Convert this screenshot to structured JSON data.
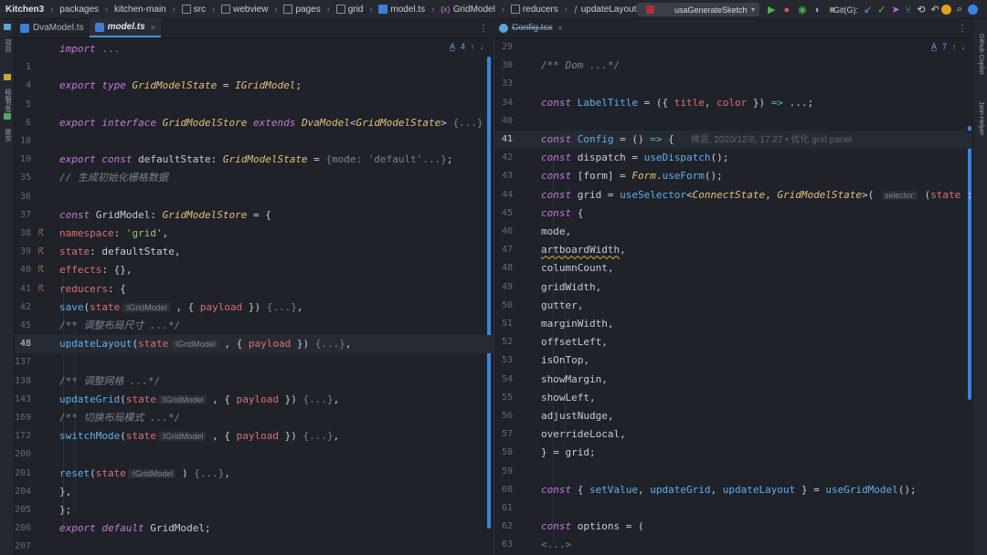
{
  "nav": {
    "breadcrumbs": [
      "Kitchen3",
      "packages",
      "kitchen-main",
      "src",
      "webview",
      "pages",
      "grid",
      "model.ts",
      "GridModel",
      "reducers",
      "updateLayout()"
    ],
    "run_config": "usaGenerateSketch",
    "git_label": "Git(G):"
  },
  "tabs_left": [
    {
      "label": "DvaModel.ts",
      "active": false
    },
    {
      "label": "model.ts",
      "active": true
    }
  ],
  "tabs_right": [
    {
      "label": "Config.tsx",
      "active": false
    }
  ],
  "left_status": {
    "warnings": "4"
  },
  "right_status": {
    "warnings": "7"
  },
  "left_strip": [
    "项目",
    "结构",
    "书签",
    "提交"
  ],
  "right_strip": [
    "Github Copilot",
    "Json Helper"
  ],
  "left_lines": [
    {
      "n": "",
      "t": [
        [
          "kw",
          "import"
        ],
        [
          "df",
          " "
        ],
        [
          "fold",
          "..."
        ]
      ]
    },
    {
      "n": "1",
      "t": []
    },
    {
      "n": "4",
      "t": [
        [
          "kw",
          "export"
        ],
        [
          "df",
          " "
        ],
        [
          "kw",
          "type"
        ],
        [
          "df",
          " "
        ],
        [
          "ty",
          "GridModelState"
        ],
        [
          "df",
          " = "
        ],
        [
          "ty",
          "IGridModel"
        ],
        [
          "df",
          ";"
        ]
      ]
    },
    {
      "n": "5",
      "t": []
    },
    {
      "n": "6",
      "t": [
        [
          "kw",
          "export"
        ],
        [
          "df",
          " "
        ],
        [
          "kw",
          "interface"
        ],
        [
          "df",
          " "
        ],
        [
          "ty",
          "GridModelStore"
        ],
        [
          "df",
          " "
        ],
        [
          "kw",
          "extends"
        ],
        [
          "df",
          " "
        ],
        [
          "ty",
          "DvaModel"
        ],
        [
          "df",
          "<"
        ],
        [
          "ty",
          "GridModelState"
        ],
        [
          "df",
          "> "
        ],
        [
          "fold",
          "{...}"
        ]
      ]
    },
    {
      "n": "18",
      "t": []
    },
    {
      "n": "19",
      "t": [
        [
          "kw",
          "export"
        ],
        [
          "df",
          " "
        ],
        [
          "kw",
          "const"
        ],
        [
          "df",
          " defaultState: "
        ],
        [
          "ty",
          "GridModelState"
        ],
        [
          "df",
          " = "
        ],
        [
          "fold",
          "{mode: 'default'...}"
        ],
        [
          "df",
          ";"
        ]
      ]
    },
    {
      "n": "35",
      "t": [
        [
          "cm",
          "// 生成初始化栅格数据"
        ]
      ]
    },
    {
      "n": "36",
      "t": []
    },
    {
      "n": "37",
      "t": [
        [
          "kw",
          "const"
        ],
        [
          "df",
          " GridModel: "
        ],
        [
          "ty",
          "GridModelStore"
        ],
        [
          "df",
          " = {"
        ]
      ]
    },
    {
      "n": "38",
      "g": true,
      "t": [
        [
          "df",
          "  "
        ],
        [
          "pr",
          "namespace"
        ],
        [
          "df",
          ": "
        ],
        [
          "st",
          "'grid'"
        ],
        [
          "df",
          ","
        ]
      ]
    },
    {
      "n": "39",
      "g": true,
      "t": [
        [
          "df",
          "  "
        ],
        [
          "pr",
          "state"
        ],
        [
          "df",
          ": defaultState,"
        ]
      ]
    },
    {
      "n": "40",
      "g": true,
      "t": [
        [
          "df",
          "  "
        ],
        [
          "pr",
          "effects"
        ],
        [
          "df",
          ": {},"
        ]
      ]
    },
    {
      "n": "41",
      "g": true,
      "t": [
        [
          "df",
          "  "
        ],
        [
          "pr",
          "reducers"
        ],
        [
          "df",
          ": {"
        ]
      ]
    },
    {
      "n": "42",
      "t": [
        [
          "df",
          "    "
        ],
        [
          "fn",
          "save"
        ],
        [
          "df",
          "("
        ],
        [
          "pr",
          "state"
        ],
        [
          "hint",
          ":IGridModel"
        ],
        [
          "df",
          " , { "
        ],
        [
          "pr",
          "payload"
        ],
        [
          "df",
          " }) "
        ],
        [
          "fold",
          "{...}"
        ],
        [
          "df",
          ","
        ]
      ]
    },
    {
      "n": "45",
      "t": [
        [
          "df",
          "    "
        ],
        [
          "cm",
          "/** 调整布局尺寸 ...*/"
        ]
      ]
    },
    {
      "n": "48",
      "cur": true,
      "t": [
        [
          "df",
          "    "
        ],
        [
          "fn",
          "updateLayout"
        ],
        [
          "df",
          "("
        ],
        [
          "pr",
          "state"
        ],
        [
          "hint",
          ":IGridModel"
        ],
        [
          "df",
          " , { "
        ],
        [
          "pr",
          "payload"
        ],
        [
          "df",
          " }) "
        ],
        [
          "fold",
          "{...}"
        ],
        [
          "df",
          ","
        ]
      ]
    },
    {
      "n": "137",
      "t": []
    },
    {
      "n": "138",
      "t": [
        [
          "df",
          "    "
        ],
        [
          "cm",
          "/** 调整网格 ...*/"
        ]
      ]
    },
    {
      "n": "143",
      "t": [
        [
          "df",
          "    "
        ],
        [
          "fn",
          "updateGrid"
        ],
        [
          "df",
          "("
        ],
        [
          "pr",
          "state"
        ],
        [
          "hint",
          ":IGridModel"
        ],
        [
          "df",
          " , { "
        ],
        [
          "pr",
          "payload"
        ],
        [
          "df",
          " }) "
        ],
        [
          "fold",
          "{...}"
        ],
        [
          "df",
          ","
        ]
      ]
    },
    {
      "n": "169",
      "t": [
        [
          "df",
          "    "
        ],
        [
          "cm",
          "/** 切换布局模式 ...*/"
        ]
      ]
    },
    {
      "n": "172",
      "t": [
        [
          "df",
          "    "
        ],
        [
          "fn",
          "switchMode"
        ],
        [
          "df",
          "("
        ],
        [
          "pr",
          "state"
        ],
        [
          "hint",
          ":IGridModel"
        ],
        [
          "df",
          " , { "
        ],
        [
          "pr",
          "payload"
        ],
        [
          "df",
          " }) "
        ],
        [
          "fold",
          "{...}"
        ],
        [
          "df",
          ","
        ]
      ]
    },
    {
      "n": "200",
      "t": []
    },
    {
      "n": "201",
      "t": [
        [
          "df",
          "    "
        ],
        [
          "fn",
          "reset"
        ],
        [
          "df",
          "("
        ],
        [
          "pr",
          "state"
        ],
        [
          "hint",
          ":IGridModel"
        ],
        [
          "df",
          " ) "
        ],
        [
          "fold",
          "{...}"
        ],
        [
          "df",
          ","
        ]
      ]
    },
    {
      "n": "204",
      "t": [
        [
          "df",
          "  },"
        ]
      ]
    },
    {
      "n": "205",
      "t": [
        [
          "df",
          "};"
        ]
      ]
    },
    {
      "n": "206",
      "t": [
        [
          "kw",
          "export"
        ],
        [
          "df",
          " "
        ],
        [
          "kw",
          "default"
        ],
        [
          "df",
          " GridModel;"
        ]
      ]
    },
    {
      "n": "207",
      "t": []
    }
  ],
  "right_lines": [
    {
      "n": "29",
      "t": []
    },
    {
      "n": "30",
      "t": [
        [
          "cm",
          "/** Dom ...*/"
        ]
      ]
    },
    {
      "n": "33",
      "t": []
    },
    {
      "n": "34",
      "t": [
        [
          "kw",
          "const"
        ],
        [
          "df",
          " "
        ],
        [
          "fn",
          "LabelTitle"
        ],
        [
          "df",
          " = ({ "
        ],
        [
          "pr",
          "title"
        ],
        [
          "df",
          ", "
        ],
        [
          "pr",
          "color"
        ],
        [
          "df",
          " }) "
        ],
        [
          "op",
          "=>"
        ],
        [
          "df",
          " ...;"
        ]
      ]
    },
    {
      "n": "40",
      "t": []
    },
    {
      "n": "41",
      "cur": true,
      "t": [
        [
          "kw",
          "const"
        ],
        [
          "df",
          " "
        ],
        [
          "fn",
          "Config"
        ],
        [
          "df",
          " = () "
        ],
        [
          "op",
          "=>"
        ],
        [
          "df",
          " {"
        ],
        [
          "blame",
          "佛昱, 2020/12/8, 17:27 • 优化 grid panel"
        ]
      ]
    },
    {
      "n": "42",
      "t": [
        [
          "df",
          "  "
        ],
        [
          "kw",
          "const"
        ],
        [
          "df",
          " dispatch = "
        ],
        [
          "fn",
          "useDispatch"
        ],
        [
          "df",
          "();"
        ]
      ]
    },
    {
      "n": "43",
      "t": [
        [
          "df",
          "  "
        ],
        [
          "kw",
          "const"
        ],
        [
          "df",
          " [form] = "
        ],
        [
          "ty",
          "Form"
        ],
        [
          "df",
          "."
        ],
        [
          "fn",
          "useForm"
        ],
        [
          "df",
          "();"
        ]
      ]
    },
    {
      "n": "44",
      "t": [
        [
          "df",
          "  "
        ],
        [
          "kw",
          "const"
        ],
        [
          "df",
          " grid = "
        ],
        [
          "fn",
          "useSelector"
        ],
        [
          "df",
          "<"
        ],
        [
          "ty",
          "ConnectState"
        ],
        [
          "df",
          ", "
        ],
        [
          "ty",
          "GridModelState"
        ],
        [
          "df",
          ">( "
        ],
        [
          "hint",
          "selector:"
        ],
        [
          "df",
          " ("
        ],
        [
          "pr",
          "state"
        ],
        [
          "df",
          " :"
        ]
      ]
    },
    {
      "n": "45",
      "t": [
        [
          "df",
          "  "
        ],
        [
          "kw",
          "const"
        ],
        [
          "df",
          " {"
        ]
      ]
    },
    {
      "n": "46",
      "t": [
        [
          "df",
          "    mode,"
        ]
      ]
    },
    {
      "n": "47",
      "t": [
        [
          "df",
          "    "
        ],
        [
          "wv",
          "artboardWidth"
        ],
        [
          "df",
          ","
        ]
      ]
    },
    {
      "n": "48",
      "t": [
        [
          "df",
          "    columnCount,"
        ]
      ]
    },
    {
      "n": "49",
      "t": [
        [
          "df",
          "    gridWidth,"
        ]
      ]
    },
    {
      "n": "50",
      "t": [
        [
          "df",
          "    gutter,"
        ]
      ]
    },
    {
      "n": "51",
      "t": [
        [
          "df",
          "    marginWidth,"
        ]
      ]
    },
    {
      "n": "52",
      "t": [
        [
          "df",
          "    offsetLeft,"
        ]
      ]
    },
    {
      "n": "53",
      "t": [
        [
          "df",
          "    isOnTop,"
        ]
      ]
    },
    {
      "n": "54",
      "t": [
        [
          "df",
          "    showMargin,"
        ]
      ]
    },
    {
      "n": "55",
      "t": [
        [
          "df",
          "    showLeft,"
        ]
      ]
    },
    {
      "n": "56",
      "t": [
        [
          "df",
          "    adjustNudge,"
        ]
      ]
    },
    {
      "n": "57",
      "t": [
        [
          "df",
          "    overrideLocal,"
        ]
      ]
    },
    {
      "n": "58",
      "t": [
        [
          "df",
          "  } = grid;"
        ]
      ]
    },
    {
      "n": "59",
      "t": []
    },
    {
      "n": "60",
      "t": [
        [
          "df",
          "  "
        ],
        [
          "kw",
          "const"
        ],
        [
          "df",
          " { "
        ],
        [
          "fn",
          "setValue"
        ],
        [
          "df",
          ", "
        ],
        [
          "fn",
          "updateGrid"
        ],
        [
          "df",
          ", "
        ],
        [
          "fn",
          "updateLayout"
        ],
        [
          "df",
          " } = "
        ],
        [
          "fn",
          "useGridModel"
        ],
        [
          "df",
          "();"
        ]
      ]
    },
    {
      "n": "61",
      "t": []
    },
    {
      "n": "62",
      "t": [
        [
          "df",
          "  "
        ],
        [
          "kw",
          "const"
        ],
        [
          "df",
          " options = ("
        ]
      ]
    },
    {
      "n": "63",
      "t": [
        [
          "df",
          "    "
        ],
        [
          "fold",
          "<...>"
        ]
      ]
    }
  ],
  "colors": {
    "accent": "#3b82e0",
    "keyword": "#c678dd",
    "type": "#e5c07b",
    "function": "#61afef",
    "property": "#e06c75",
    "string": "#98c379"
  }
}
